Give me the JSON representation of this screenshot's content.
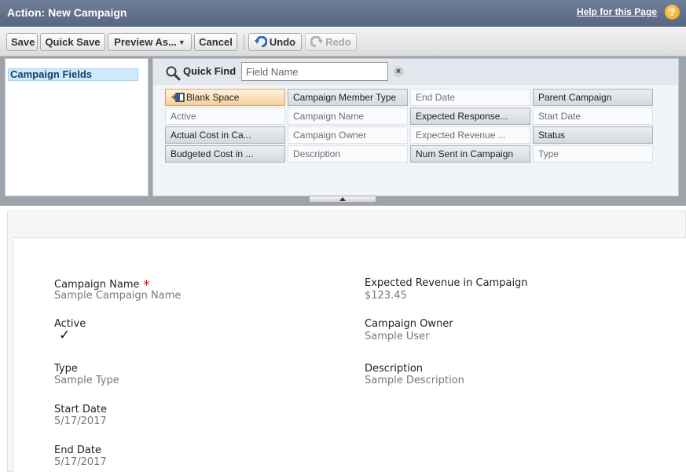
{
  "title_bar": {
    "title": "Action: New Campaign",
    "help_link": "Help for this Page",
    "help_icon": "?"
  },
  "toolbar": {
    "save": "Save",
    "quick_save": "Quick Save",
    "preview_as": "Preview As...",
    "cancel": "Cancel",
    "undo": "Undo",
    "redo": "Redo"
  },
  "palette": {
    "category": "Campaign Fields",
    "quick_find_label": "Quick Find",
    "quick_find_placeholder": "Field Name",
    "clear_icon": "×",
    "fields": [
      [
        "Blank Space",
        "Campaign Member Type",
        "End Date",
        "Parent Campaign"
      ],
      [
        "Active",
        "Campaign Name",
        "Expected Response...",
        "Start Date"
      ],
      [
        "Actual Cost in Ca...",
        "Campaign Owner",
        "Expected Revenue ...",
        "Status"
      ],
      [
        "Budgeted Cost in ...",
        "Description",
        "Num Sent in Campaign",
        "Type"
      ]
    ]
  },
  "layout": {
    "left": [
      {
        "label": "Campaign Name",
        "value": "Sample Campaign Name",
        "required": "*"
      },
      {
        "label": "Active",
        "check": "✓"
      },
      {
        "label": "Type",
        "value": "Sample Type"
      },
      {
        "label": "Start Date",
        "value": "5/17/2017"
      },
      {
        "label": "End Date",
        "value": "5/17/2017"
      }
    ],
    "right": [
      {
        "label": "Expected Revenue in Campaign",
        "value": "$123.45"
      },
      {
        "label": "Campaign Owner",
        "value": "Sample User"
      },
      {
        "label": "Description",
        "value": "Sample Description"
      }
    ]
  }
}
